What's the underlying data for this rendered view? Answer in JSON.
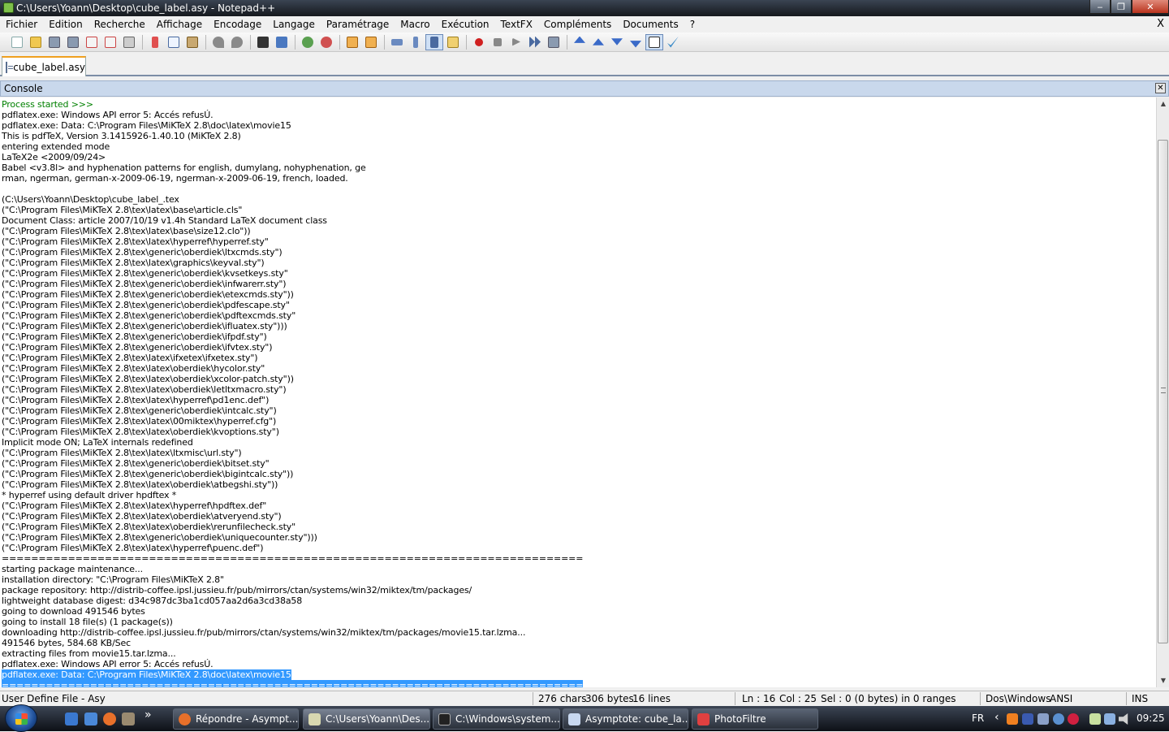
{
  "window": {
    "title": "C:\\Users\\Yoann\\Desktop\\cube_label.asy - Notepad++",
    "minimize": "‒",
    "maximize": "❐",
    "close": "✕"
  },
  "menu": {
    "items": [
      "Fichier",
      "Edition",
      "Recherche",
      "Affichage",
      "Encodage",
      "Langage",
      "Paramétrage",
      "Macro",
      "Exécution",
      "TextFX",
      "Compléments",
      "Documents",
      "?"
    ],
    "close": "X"
  },
  "tab": {
    "label": "cube_label.asy"
  },
  "console": {
    "title": "Console",
    "close": "✕",
    "lines": [
      "Process started >>>",
      "pdflatex.exe: Windows API error 5: Accés refusÚ.",
      "pdflatex.exe: Data: C:\\Program Files\\MiKTeX 2.8\\doc\\latex\\movie15",
      "This is pdfTeX, Version 3.1415926-1.40.10 (MiKTeX 2.8)",
      "entering extended mode",
      "LaTeX2e <2009/09/24>",
      "Babel <v3.8l> and hyphenation patterns for english, dumylang, nohyphenation, ge",
      "rman, ngerman, german-x-2009-06-19, ngerman-x-2009-06-19, french, loaded.",
      "",
      "(C:\\Users\\Yoann\\Desktop\\cube_label_.tex",
      "(\"C:\\Program Files\\MiKTeX 2.8\\tex\\latex\\base\\article.cls\"",
      "Document Class: article 2007/10/19 v1.4h Standard LaTeX document class",
      "(\"C:\\Program Files\\MiKTeX 2.8\\tex\\latex\\base\\size12.clo\"))",
      "(\"C:\\Program Files\\MiKTeX 2.8\\tex\\latex\\hyperref\\hyperref.sty\"",
      "(\"C:\\Program Files\\MiKTeX 2.8\\tex\\generic\\oberdiek\\ltxcmds.sty\")",
      "(\"C:\\Program Files\\MiKTeX 2.8\\tex\\latex\\graphics\\keyval.sty\")",
      "(\"C:\\Program Files\\MiKTeX 2.8\\tex\\generic\\oberdiek\\kvsetkeys.sty\"",
      "(\"C:\\Program Files\\MiKTeX 2.8\\tex\\generic\\oberdiek\\infwarerr.sty\")",
      "(\"C:\\Program Files\\MiKTeX 2.8\\tex\\generic\\oberdiek\\etexcmds.sty\"))",
      "(\"C:\\Program Files\\MiKTeX 2.8\\tex\\generic\\oberdiek\\pdfescape.sty\"",
      "(\"C:\\Program Files\\MiKTeX 2.8\\tex\\generic\\oberdiek\\pdftexcmds.sty\"",
      "(\"C:\\Program Files\\MiKTeX 2.8\\tex\\generic\\oberdiek\\ifluatex.sty\")))",
      "(\"C:\\Program Files\\MiKTeX 2.8\\tex\\generic\\oberdiek\\ifpdf.sty\")",
      "(\"C:\\Program Files\\MiKTeX 2.8\\tex\\generic\\oberdiek\\ifvtex.sty\")",
      "(\"C:\\Program Files\\MiKTeX 2.8\\tex\\latex\\ifxetex\\ifxetex.sty\")",
      "(\"C:\\Program Files\\MiKTeX 2.8\\tex\\latex\\oberdiek\\hycolor.sty\"",
      "(\"C:\\Program Files\\MiKTeX 2.8\\tex\\latex\\oberdiek\\xcolor-patch.sty\"))",
      "(\"C:\\Program Files\\MiKTeX 2.8\\tex\\latex\\oberdiek\\letltxmacro.sty\")",
      "(\"C:\\Program Files\\MiKTeX 2.8\\tex\\latex\\hyperref\\pd1enc.def\")",
      "(\"C:\\Program Files\\MiKTeX 2.8\\tex\\generic\\oberdiek\\intcalc.sty\")",
      "(\"C:\\Program Files\\MiKTeX 2.8\\tex\\latex\\00miktex\\hyperref.cfg\")",
      "(\"C:\\Program Files\\MiKTeX 2.8\\tex\\latex\\oberdiek\\kvoptions.sty\")",
      "Implicit mode ON; LaTeX internals redefined",
      "(\"C:\\Program Files\\MiKTeX 2.8\\tex\\latex\\ltxmisc\\url.sty\")",
      "(\"C:\\Program Files\\MiKTeX 2.8\\tex\\generic\\oberdiek\\bitset.sty\"",
      "(\"C:\\Program Files\\MiKTeX 2.8\\tex\\generic\\oberdiek\\bigintcalc.sty\"))",
      "(\"C:\\Program Files\\MiKTeX 2.8\\tex\\latex\\oberdiek\\atbegshi.sty\"))",
      "* hyperref using default driver hpdftex *",
      "(\"C:\\Program Files\\MiKTeX 2.8\\tex\\latex\\hyperref\\hpdftex.def\"",
      "(\"C:\\Program Files\\MiKTeX 2.8\\tex\\latex\\oberdiek\\atveryend.sty\")",
      "(\"C:\\Program Files\\MiKTeX 2.8\\tex\\latex\\oberdiek\\rerunfilecheck.sty\"",
      "(\"C:\\Program Files\\MiKTeX 2.8\\tex\\generic\\oberdiek\\uniquecounter.sty\")))",
      "(\"C:\\Program Files\\MiKTeX 2.8\\tex\\latex\\hyperref\\puenc.def\")",
      "===============================================================================",
      "starting package maintenance...",
      "installation directory: \"C:\\Program Files\\MiKTeX 2.8\"",
      "package repository: http://distrib-coffee.ipsl.jussieu.fr/pub/mirrors/ctan/systems/win32/miktex/tm/packages/",
      "lightweight database digest: d34c987dc3ba1cd057aa2d6a3cd38a58",
      "going to download 491546 bytes",
      "going to install 18 file(s) (1 package(s))",
      "downloading http://distrib-coffee.ipsl.jussieu.fr/pub/mirrors/ctan/systems/win32/miktex/tm/packages/movie15.tar.lzma...",
      "491546 bytes, 584.68 KB/Sec",
      "extracting files from movie15.tar.lzma...",
      "pdflatex.exe: Windows API error 5: Accés refusÚ.",
      "pdflatex.exe: Data: C:\\Program Files\\MiKTeX 2.8\\doc\\latex\\movie15",
      "==============================================================================="
    ]
  },
  "statusbar": {
    "filetype": "User Define File - Asy",
    "chars": "276 chars",
    "bytes": "306 bytes",
    "lines": "16 lines",
    "ln": "Ln : 16",
    "col": "Col : 25",
    "sel": "Sel : 0 (0 bytes) in 0 ranges",
    "eol": "Dos\\Windows",
    "encoding": "ANSI",
    "mode": "INS"
  },
  "taskbar": {
    "more": "»",
    "tasks": [
      {
        "label": "Répondre - Asympt...",
        "color": "#e8702a"
      },
      {
        "label": "C:\\Users\\Yoann\\Des...",
        "color": "#d8d8b0"
      },
      {
        "label": "C:\\Windows\\system...",
        "color": "#333333"
      },
      {
        "label": "Asymptote: cube_la...",
        "color": "#c8d8f0"
      },
      {
        "label": "PhotoFiltre",
        "color": "#e04040"
      }
    ],
    "lang": "FR",
    "chevron": "‹",
    "clock": "09:25"
  },
  "colors": {
    "console_header": "#c9d8ec",
    "selection": "#3399ff",
    "process_text": "#008000"
  }
}
